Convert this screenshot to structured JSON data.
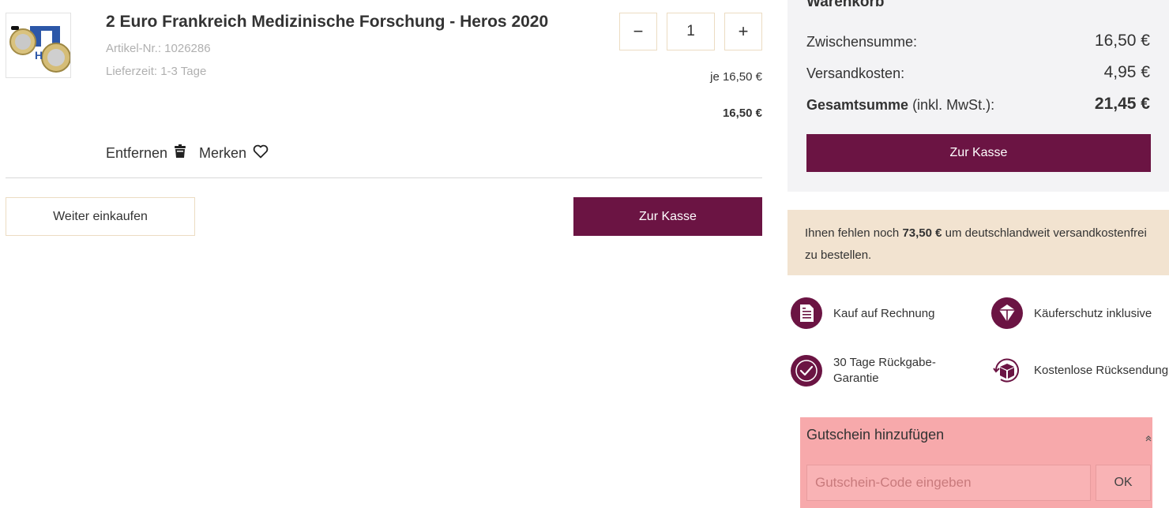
{
  "product": {
    "title": "2 Euro Frankreich Medizinische Forschung - Heros 2020",
    "article_no": "Artikel-Nr.: 1026286",
    "delivery": "Lieferzeit: 1-3 Tage",
    "quantity": "1",
    "unit_price": "je 16,50 €",
    "line_total": "16,50 €",
    "remove_label": "Entfernen",
    "remember_label": "Merken",
    "decrease_symbol": "−",
    "increase_symbol": "+"
  },
  "actions": {
    "continue_label": "Weiter einkaufen",
    "checkout_label": "Zur Kasse"
  },
  "cart": {
    "heading": "Warenkorb",
    "subtotal_label": "Zwischensumme:",
    "subtotal_value": "16,50 €",
    "shipping_label": "Versandkosten:",
    "shipping_value": "4,95 €",
    "total_label": "Gesamtsumme",
    "total_note": " (inkl. MwSt.):",
    "total_value": "21,45 €",
    "checkout_label": "Zur Kasse"
  },
  "shipping_notice": {
    "prefix": "Ihnen fehlen noch ",
    "amount": "73,50 €",
    "suffix": " um deutschlandweit versandkostenfrei zu bestellen."
  },
  "features": [
    {
      "label": "Kauf auf Rechnung",
      "icon": "invoice-icon"
    },
    {
      "label": "Käuferschutz inklusive",
      "icon": "shield-icon"
    },
    {
      "label": "30 Tage Rückgabe-Garantie",
      "icon": "check-badge-icon"
    },
    {
      "label": "Kostenlose Rücksendung",
      "icon": "return-box-icon"
    }
  ],
  "coupon": {
    "title": "Gutschein hinzufügen",
    "placeholder": "Gutschein-Code eingeben",
    "ok_label": "OK"
  },
  "colors": {
    "primary": "#6b1443",
    "cart_bg": "#f3f3f5",
    "notice_bg": "#f2e3d0",
    "coupon_bg": "#f7a9ab"
  }
}
